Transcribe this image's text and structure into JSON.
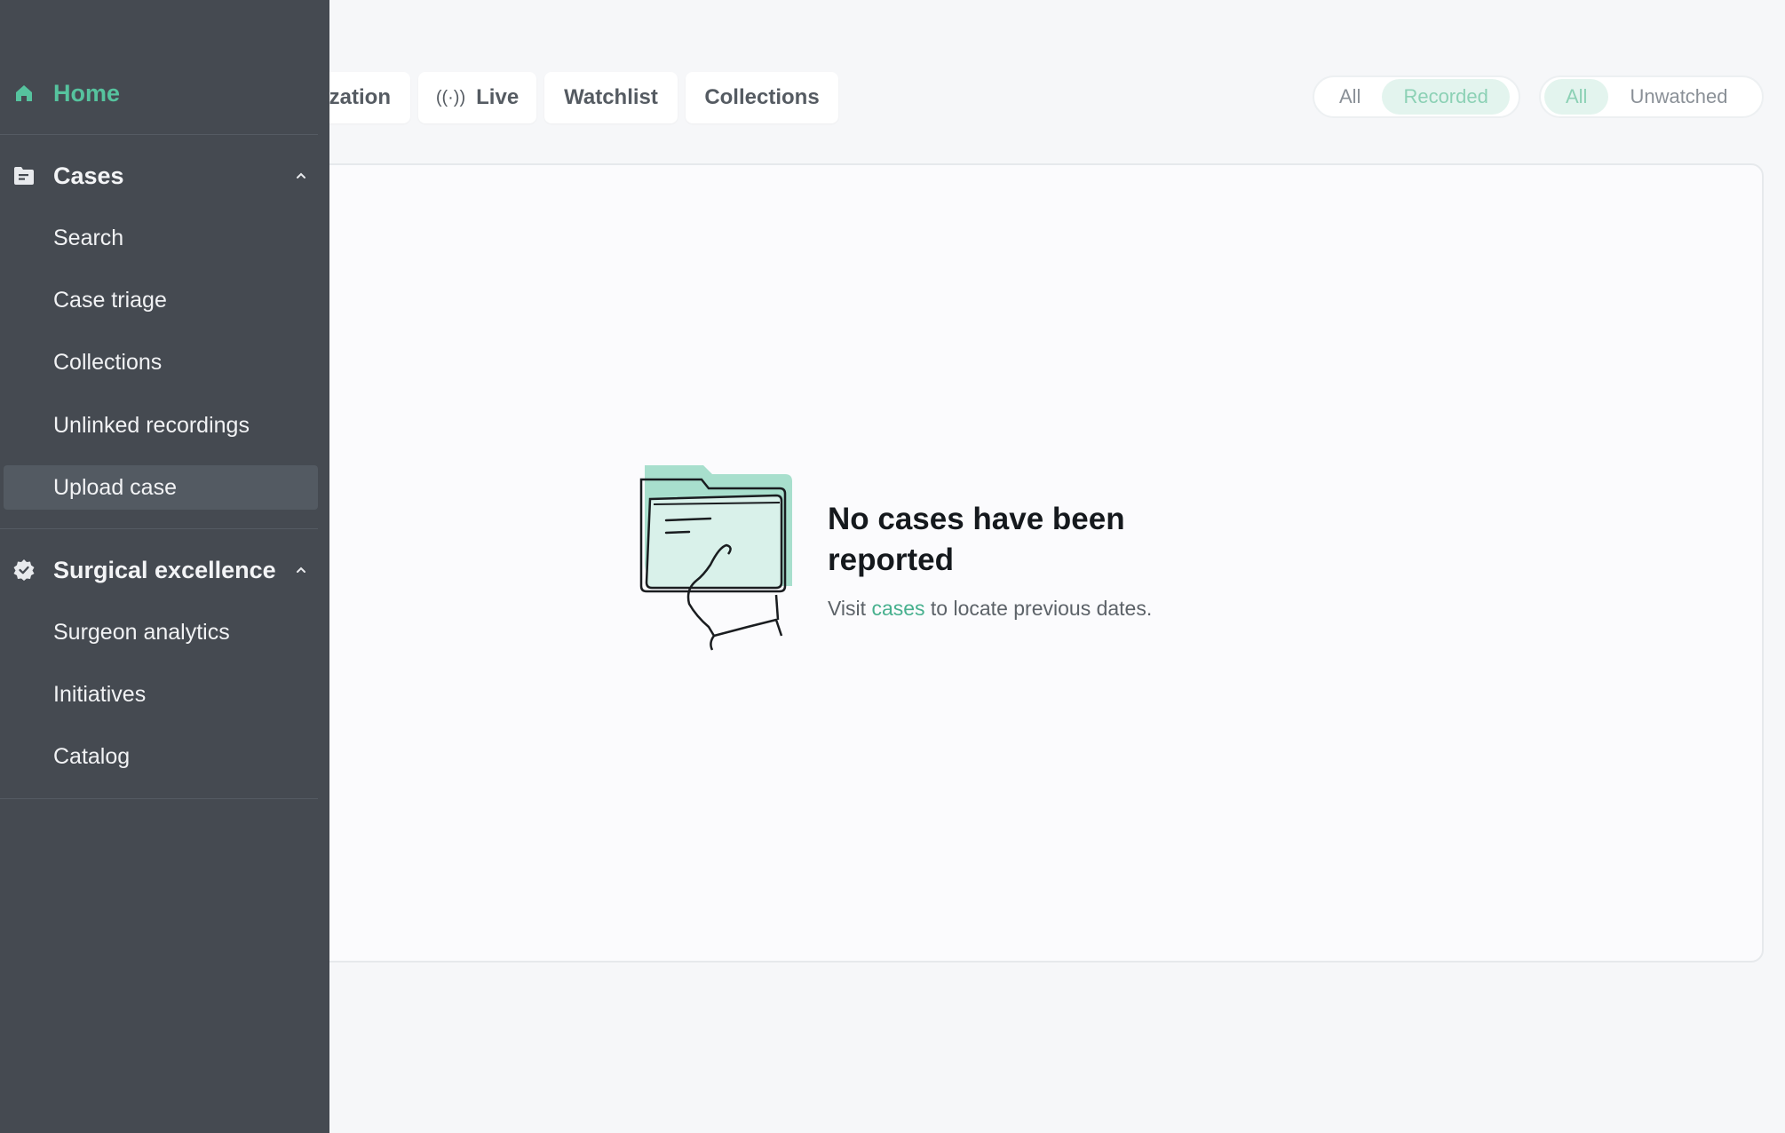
{
  "sidebar": {
    "home": {
      "label": "Home",
      "icon": "home-icon"
    },
    "cases": {
      "label": "Cases",
      "icon": "folder-icon",
      "items": [
        "Search",
        "Case triage",
        "Collections",
        "Unlinked recordings",
        "Upload case"
      ],
      "selected": "Upload case"
    },
    "surgical": {
      "label": "Surgical excellence",
      "icon": "badge-check-icon",
      "items": [
        "Surgeon analytics",
        "Initiatives",
        "Catalog"
      ]
    }
  },
  "tabs": {
    "organization": "zation",
    "live": "Live",
    "live_icon": "broadcast-icon",
    "watchlist": "Watchlist",
    "collections": "Collections"
  },
  "filters": {
    "group1": {
      "options": [
        "All",
        "Recorded"
      ],
      "active": "Recorded"
    },
    "group2": {
      "options": [
        "All",
        "Unwatched"
      ],
      "active": "All"
    }
  },
  "empty_state": {
    "title": "No cases have been reported",
    "sub_prefix": "Visit",
    "sub_link": "cases",
    "sub_suffix": "to locate previous dates.",
    "illustration": "folder-in-hand-illustration"
  },
  "colors": {
    "sidebar_bg": "#454a51",
    "accent": "#56c39e",
    "link": "#47b08e",
    "active_filter_bg": "#e3f4ee",
    "active_filter_text": "#8cd1b5"
  }
}
